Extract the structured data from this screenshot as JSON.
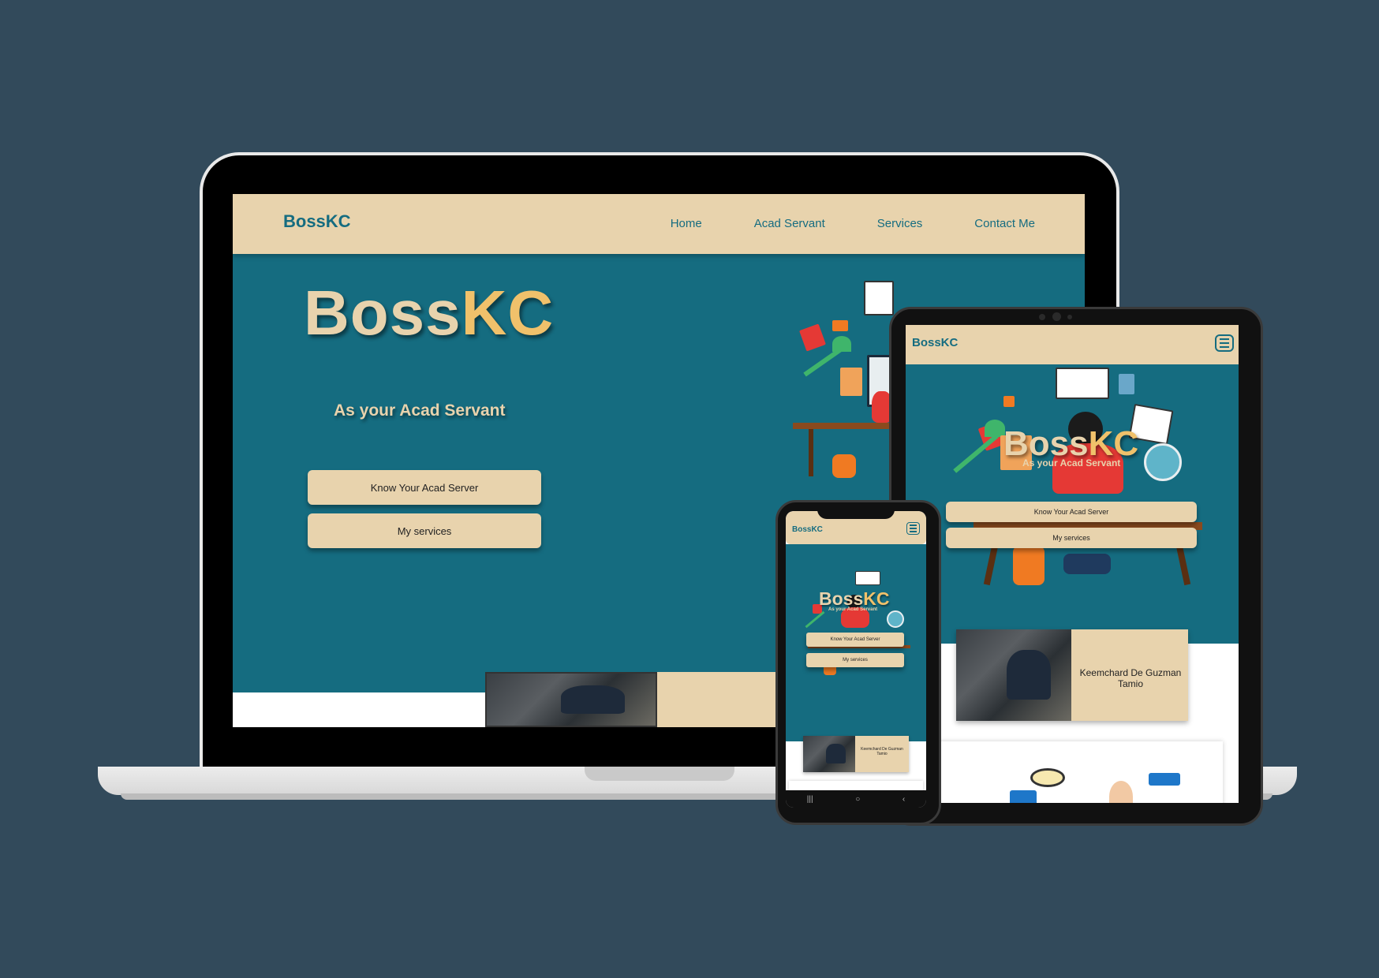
{
  "site": {
    "brand": "BossKC",
    "brand_main": "Boss",
    "brand_accent": "KC",
    "subtitle": "As your Acad Servant",
    "nav": [
      "Home",
      "Acad Servant",
      "Services",
      "Contact Me"
    ],
    "buttons": {
      "primary": "Know Your Acad Server",
      "secondary": "My services"
    },
    "profile_name": "Keemchard De Guzman Tamio"
  },
  "icons": {
    "menu": "hamburger-menu-icon"
  },
  "colors": {
    "background": "#324a5b",
    "hero": "#156c80",
    "nav": "#e8d3ad",
    "accent": "#f0c16b"
  }
}
